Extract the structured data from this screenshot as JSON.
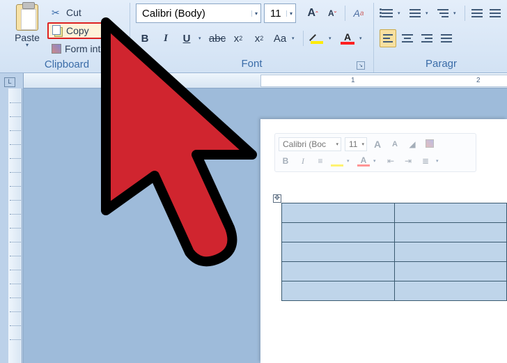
{
  "clipboard": {
    "group_label": "Clipboard",
    "paste_label": "Paste",
    "cut_label": "Cut",
    "copy_label": "Copy",
    "format_painter_label": "Form        inter"
  },
  "font": {
    "group_label": "Font",
    "name": "Calibri (Body)",
    "size": "11",
    "bold": "B",
    "italic": "I",
    "underline": "U",
    "strike": "abc",
    "subscript_base": "x",
    "subscript_sub": "2",
    "superscript_base": "x",
    "superscript_sup": "2",
    "changecase": "Aa",
    "fontcolor_letter": "A",
    "highlight_color": "#ffeb00",
    "font_color": "#ff2020"
  },
  "paragraph": {
    "group_label": "Paragr"
  },
  "ruler": {
    "mark_1": "1",
    "mark_2": "2"
  },
  "mini_toolbar": {
    "font_name": "Calibri (Boc",
    "font_size": "11",
    "grow_A": "A",
    "shrink_A": "A",
    "bold": "B",
    "italic": "I",
    "fontcolor_letter": "A"
  },
  "table": {
    "rows": 5,
    "cols": 2
  }
}
